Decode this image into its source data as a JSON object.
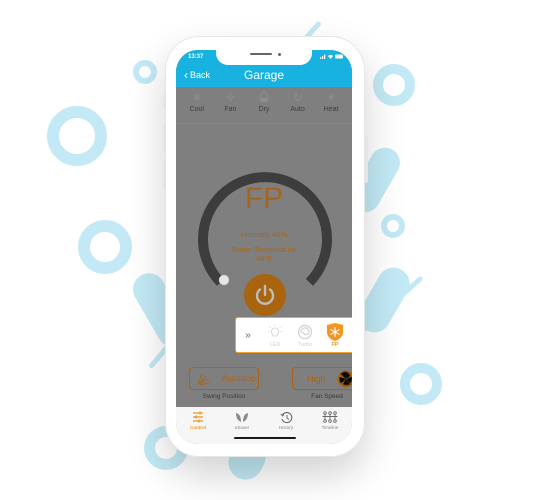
{
  "status_bar": {
    "time": "13:37",
    "icons": "signal wifi battery"
  },
  "header": {
    "back_label": "Back",
    "title": "Garage",
    "accent": "#18b2e0"
  },
  "modes": [
    {
      "label": "Cool",
      "icon": "snowflake-icon",
      "glyph": "❄"
    },
    {
      "label": "Fan",
      "icon": "fan-icon",
      "glyph": "✣"
    },
    {
      "label": "Dry",
      "icon": "droplet-icon",
      "glyph": "💧"
    },
    {
      "label": "Auto",
      "icon": "cycle-icon",
      "glyph": "↻"
    },
    {
      "label": "Heat",
      "icon": "sun-icon",
      "glyph": "☀"
    }
  ],
  "display": {
    "mode_text": "FP",
    "humidity": "Humidity 46%",
    "room_temp_label": "Room Temperature",
    "room_temp_value": "46°F",
    "dial_value_fraction": 0.0,
    "text_color": "#a8651a"
  },
  "popup": {
    "expand_glyph": "»",
    "items": [
      {
        "label": "LED",
        "icon": "bulb-icon",
        "active": false
      },
      {
        "label": "Turbo",
        "icon": "swirl-icon",
        "active": false
      },
      {
        "label": "FP",
        "icon": "shield-snowflake-icon",
        "active": true
      }
    ]
  },
  "controls": {
    "swing": {
      "value": "Auto/stop",
      "label": "Swing Position"
    },
    "fan": {
      "value": "High",
      "label": "Fan Speed"
    }
  },
  "tabs": [
    {
      "label": "Control",
      "icon": "sliders-icon",
      "active": true
    },
    {
      "label": "eSaver",
      "icon": "leaf-icon",
      "active": false
    },
    {
      "label": "History",
      "icon": "history-icon",
      "active": false
    },
    {
      "label": "Timeline",
      "icon": "timeline-icon",
      "active": false
    }
  ],
  "colors": {
    "active": "#f5941f",
    "brown": "#a8651a",
    "deco": "#c2e9f5"
  }
}
